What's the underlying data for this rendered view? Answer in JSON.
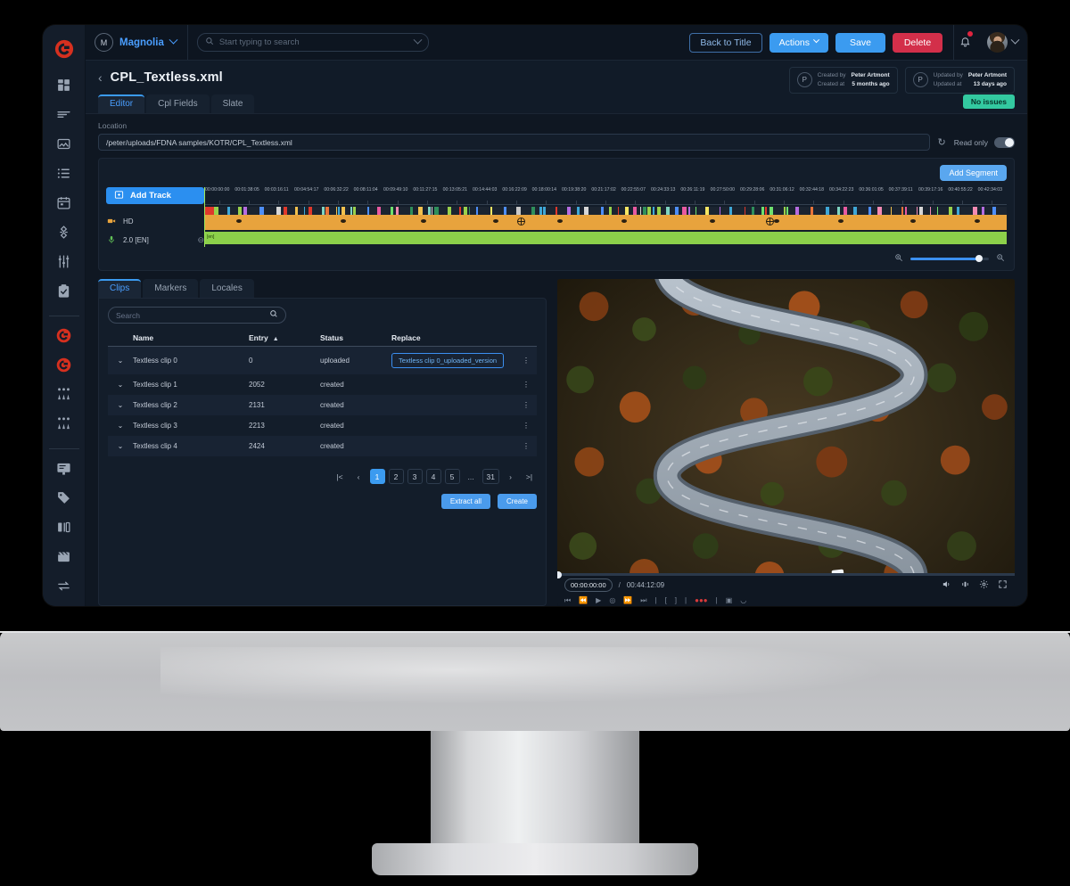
{
  "topbar": {
    "tenant_initial": "M",
    "tenant_name": "Magnolia",
    "search_placeholder": "Start typing to search",
    "search_value": "",
    "back_to_title": "Back to Title",
    "actions": "Actions",
    "save": "Save",
    "delete": "Delete",
    "icons": {
      "search": "search-icon",
      "bell": "bell-icon",
      "chevron": "chevron-down-icon"
    }
  },
  "page": {
    "title": "CPL_Textless.xml",
    "badge": "No issues",
    "badge_color": "#33c9a0",
    "tabs": [
      {
        "label": "Editor",
        "active": true
      },
      {
        "label": "Cpl Fields",
        "active": false
      },
      {
        "label": "Slate",
        "active": false
      }
    ],
    "meta": [
      {
        "initial": "P",
        "label_by": "Created by",
        "label_at": "Created at",
        "value_by": "Peter Artmont",
        "value_at": "5 months ago"
      },
      {
        "initial": "P",
        "label_by": "Updated by",
        "label_at": "Updated at",
        "value_by": "Peter Artmont",
        "value_at": "13 days ago"
      }
    ]
  },
  "location": {
    "label": "Location",
    "value": "/peter/uploads/FDNA samples/KOTR/CPL_Textless.xml",
    "placeholder": "",
    "readonly_label": "Read only",
    "readonly_on": true
  },
  "timeline": {
    "add_segment": "Add Segment",
    "add_track": "Add Track",
    "tracks": [
      {
        "name": "HD",
        "icon": "video-camera-icon"
      },
      {
        "name": "2.0 [EN]",
        "icon": "microphone-icon"
      }
    ],
    "audio_clip_label": "[en]",
    "zoom_level": 87,
    "ruler_ticks": [
      "00:00:00:00",
      "00:01:38:05",
      "00:03:16:11",
      "00:04:54:17",
      "00:06:32:22",
      "00:08:11:04",
      "00:09:49:10",
      "00:11:27:15",
      "00:13:05:21",
      "00:14:44:03",
      "00:16:22:09",
      "00:18:00:14",
      "00:19:38:20",
      "00:21:17:02",
      "00:22:55:07",
      "00:24:33:13",
      "00:26:11:19",
      "00:27:50:00",
      "00:29:28:06",
      "00:31:06:12",
      "00:32:44:18",
      "00:34:22:23",
      "00:36:01:05",
      "00:37:39:11",
      "00:39:17:16",
      "00:40:55:22",
      "00:42:34:03"
    ]
  },
  "clips": {
    "tabs": [
      {
        "label": "Clips",
        "active": true
      },
      {
        "label": "Markers",
        "active": false
      },
      {
        "label": "Locales",
        "active": false
      }
    ],
    "search_placeholder": "Search",
    "search_value": "",
    "columns": [
      "Name",
      "Entry",
      "Status",
      "Replace"
    ],
    "sort_column": "Entry",
    "sort_direction": "asc",
    "rows": [
      {
        "name": "Textless clip 0",
        "entry": "0",
        "status": "uploaded",
        "replace": "Textless clip 0_uploaded_version"
      },
      {
        "name": "Textless clip 1",
        "entry": "2052",
        "status": "created",
        "replace": ""
      },
      {
        "name": "Textless clip 2",
        "entry": "2131",
        "status": "created",
        "replace": ""
      },
      {
        "name": "Textless clip 3",
        "entry": "2213",
        "status": "created",
        "replace": ""
      },
      {
        "name": "Textless clip 4",
        "entry": "2424",
        "status": "created",
        "replace": ""
      }
    ],
    "pagination": {
      "first": "|<",
      "prev": "‹",
      "pages": [
        "1",
        "2",
        "3",
        "4",
        "5",
        "...",
        "31"
      ],
      "current": "1",
      "next": "›",
      "last": ">|"
    },
    "extract_all": "Extract all",
    "create": "Create"
  },
  "player": {
    "current_time": "00:00:00:00",
    "separator": "/",
    "total_time": "00:44:12:09",
    "icons": [
      "volume-icon",
      "audio-track-icon",
      "gear-icon",
      "fullscreen-icon"
    ]
  },
  "sidebar": {
    "logo": "brand-logo-icon",
    "items": [
      {
        "name": "dashboard-icon"
      },
      {
        "name": "lines-icon"
      },
      {
        "name": "image-icon"
      },
      {
        "name": "list-icon"
      },
      {
        "name": "calendar-icon"
      },
      {
        "name": "node-icon"
      },
      {
        "name": "sliders-icon"
      },
      {
        "name": "clipboard-check-icon"
      },
      {
        "name": "brand-logo-red-icon"
      },
      {
        "name": "brand-logo-red-2-icon"
      },
      {
        "name": "mixer-icon"
      },
      {
        "name": "mixer-2-icon"
      },
      {
        "name": "monitor-icon"
      },
      {
        "name": "tag-icon"
      },
      {
        "name": "compare-icon"
      },
      {
        "name": "film-icon"
      },
      {
        "name": "loop-icon"
      }
    ]
  },
  "colors": {
    "accent_blue": "#3b9bf0",
    "danger_red": "#d32f4a",
    "success_teal": "#33c9a0",
    "video_track": "#e8a33d",
    "audio_track": "#8cd04a",
    "brand_red": "#d6301f",
    "app_bg": "#0f1722"
  }
}
